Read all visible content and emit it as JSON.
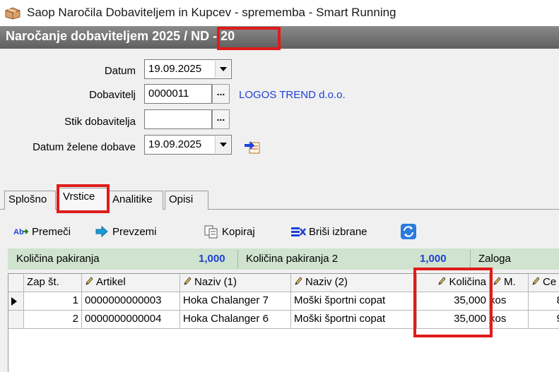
{
  "window": {
    "title": "Saop  Naročila Dobaviteljem in Kupcev - sprememba - Smart Running"
  },
  "header": {
    "title": "Naročanje dobaviteljem 2025 / ND - 20"
  },
  "form": {
    "datum_label": "Datum",
    "datum_value": "19.09.2025",
    "dobavitelj_label": "Dobavitelj",
    "dobavitelj_value": "0000011",
    "dobavitelj_name": "LOGOS TREND d.o.o.",
    "stik_label": "Stik dobavitelja",
    "stik_value": "",
    "datum_zelene_label": "Datum želene dobave",
    "datum_zelene_value": "19.09.2025",
    "dots_label": "..."
  },
  "tabs": [
    {
      "label": "Splošno"
    },
    {
      "label": "Vrstice"
    },
    {
      "label": "Analitike"
    },
    {
      "label": "Opisi"
    }
  ],
  "toolbar": {
    "premeci": "Premeči",
    "prevzemi": "Prevzemi",
    "kopiraj": "Kopiraj",
    "brisi": "Briši izbrane"
  },
  "stats": {
    "kol_pak_label": "Količina pakiranja",
    "kol_pak_value": "1,000",
    "kol_pak2_label": "Količina pakiranja 2",
    "kol_pak2_value": "1,000",
    "zaloga_label": "Zaloga"
  },
  "table": {
    "columns": [
      "Zap št.",
      "Artikel",
      "Naziv (1)",
      "Naziv (2)",
      "Količina",
      "M.",
      "Ce"
    ],
    "rows": [
      [
        "1",
        "0000000000003",
        "Hoka Chalanger 7",
        "Moški športni copat",
        "35,000",
        "kos",
        "8"
      ],
      [
        "2",
        "0000000000004",
        "Hoka Chalanger 6",
        "Moški športni copat",
        "35,000",
        "kos",
        "9"
      ]
    ]
  },
  "colors": {
    "highlight": "#e01b1b",
    "link_blue": "#1f3fd8",
    "stats_bg": "#cfe3cf"
  }
}
